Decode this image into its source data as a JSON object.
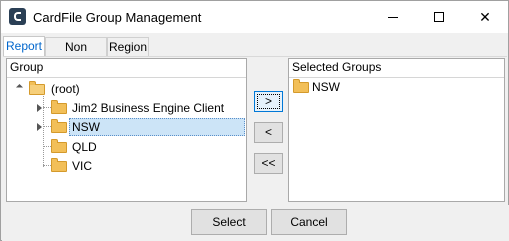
{
  "window": {
    "title": "CardFile Group Management"
  },
  "tabs": [
    {
      "label": "Report",
      "active": true
    },
    {
      "label": "Non Report",
      "active": false
    },
    {
      "label": "Region",
      "active": false
    }
  ],
  "left_panel": {
    "header": "Group",
    "tree": {
      "root": "(root)",
      "children": [
        {
          "label": "Jim2 Business Engine Client",
          "expandable": true
        },
        {
          "label": "NSW",
          "expandable": true,
          "selected": true
        },
        {
          "label": "QLD",
          "expandable": false
        },
        {
          "label": "VIC",
          "expandable": false
        }
      ]
    }
  },
  "right_panel": {
    "header": "Selected Groups",
    "items": [
      {
        "label": "NSW"
      }
    ]
  },
  "mid_buttons": {
    "add": ">",
    "remove": "<",
    "remove_all": "<<"
  },
  "footer": {
    "select_label": "Select",
    "cancel_label": "Cancel"
  },
  "colors": {
    "accent": "#0066cc",
    "selection": "#cce4f7",
    "folder": "#f2bf58"
  }
}
